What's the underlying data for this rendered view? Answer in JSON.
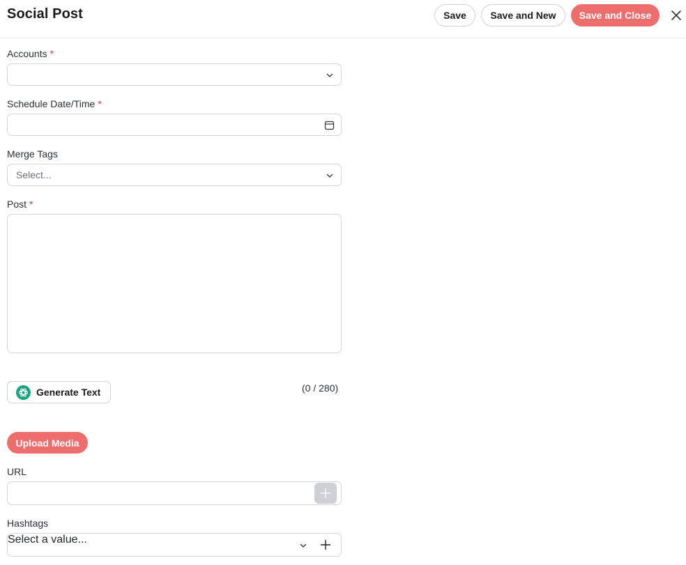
{
  "header": {
    "title": "Social Post",
    "save_label": "Save",
    "save_new_label": "Save and New",
    "save_close_label": "Save and Close",
    "close_icon": "close-icon"
  },
  "colors": {
    "primary": "#ee6e6e",
    "required": "#d9363e",
    "border": "#d4d7db"
  },
  "form": {
    "accounts": {
      "label": "Accounts",
      "required_mark": "*",
      "value": "",
      "icon": "chevron-down-icon"
    },
    "schedule": {
      "label": "Schedule Date/Time",
      "required_mark": "*",
      "value": "",
      "icon": "calendar-icon"
    },
    "merge_tags": {
      "label": "Merge Tags",
      "placeholder": "Select...",
      "icon": "chevron-down-icon"
    },
    "post": {
      "label": "Post",
      "required_mark": "*",
      "value": ""
    },
    "generate_text_label": "Generate Text",
    "generate_icon": "openai-icon",
    "char_counter": "(0 / 280)",
    "upload_media_label": "Upload Media",
    "url": {
      "label": "URL",
      "value": "",
      "add_icon": "plus-icon"
    },
    "hashtags": {
      "label": "Hashtags",
      "placeholder": "Select a value...",
      "icon": "chevron-down-icon",
      "add_icon": "plus-icon"
    }
  }
}
